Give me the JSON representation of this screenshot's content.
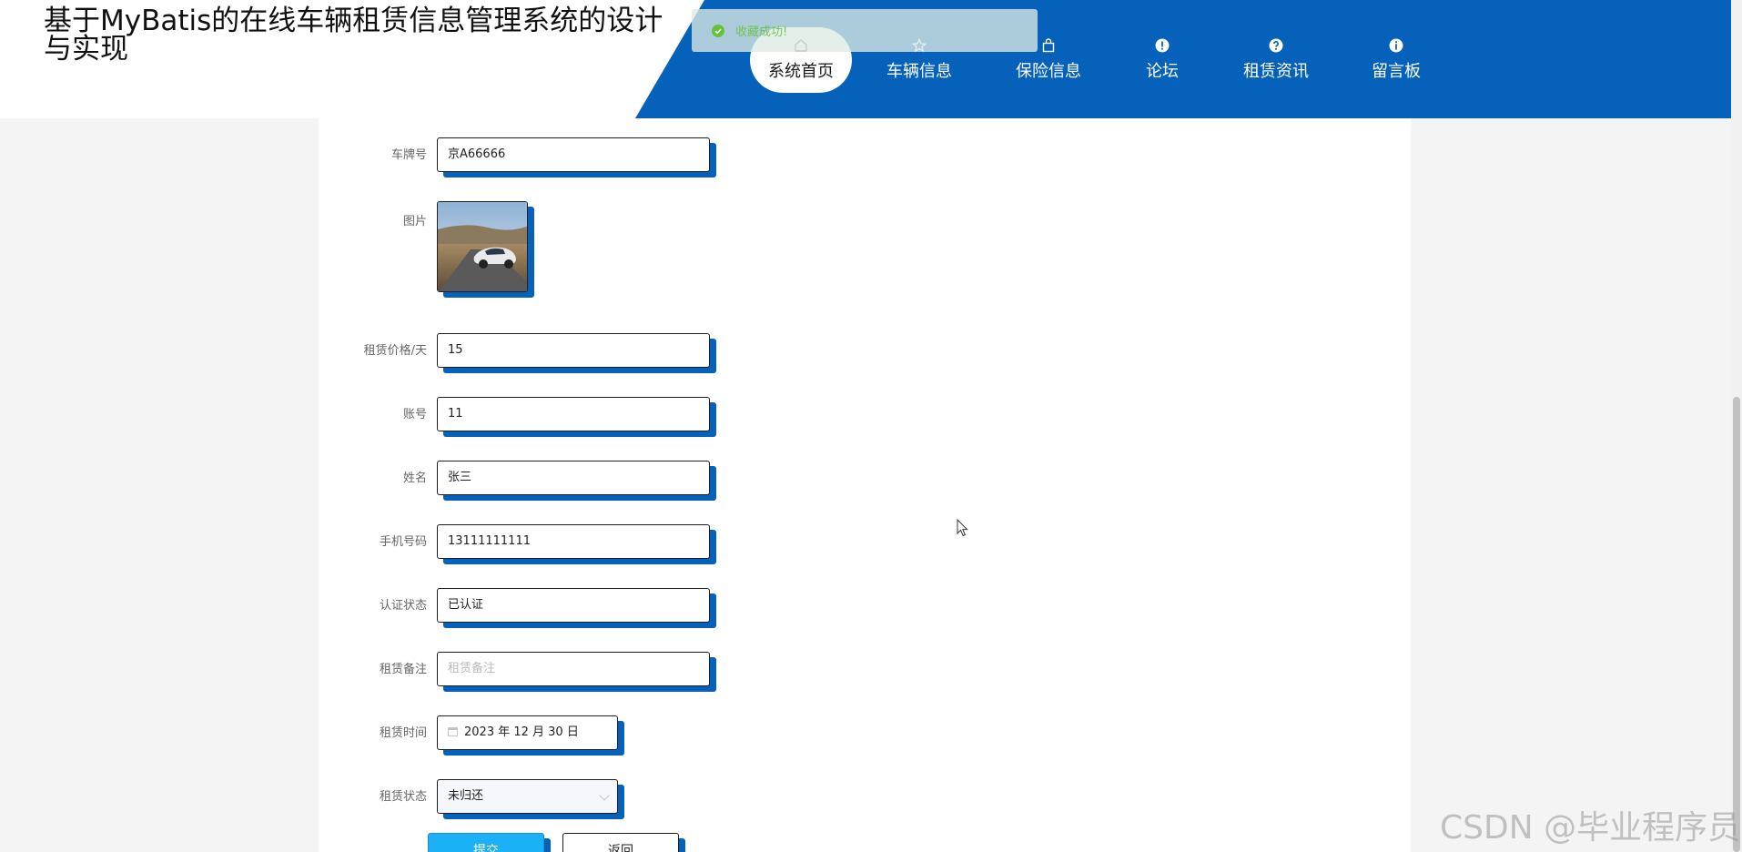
{
  "header": {
    "title": "基于MyBatis的在线车辆租赁信息管理系统的设计与实现"
  },
  "nav": {
    "items": [
      {
        "label": "系统首页",
        "icon": "home-icon"
      },
      {
        "label": "车辆信息",
        "icon": "star-icon"
      },
      {
        "label": "保险信息",
        "icon": "bag-icon"
      },
      {
        "label": "论坛",
        "icon": "exclamation-icon"
      },
      {
        "label": "租赁资讯",
        "icon": "question-icon"
      },
      {
        "label": "留言板",
        "icon": "info-icon"
      }
    ],
    "active_index": 0
  },
  "toast": {
    "text": "收藏成功!",
    "status": "success",
    "color": "#67c23a"
  },
  "form": {
    "plate": {
      "label": "车牌号",
      "value": "京A66666"
    },
    "photo": {
      "label": "图片"
    },
    "price": {
      "label": "租赁价格/天",
      "value": "15"
    },
    "account": {
      "label": "账号",
      "value": "11"
    },
    "name": {
      "label": "姓名",
      "value": "张三"
    },
    "phone": {
      "label": "手机号码",
      "value": "13111111111"
    },
    "auth_status": {
      "label": "认证状态",
      "value": "已认证"
    },
    "remark": {
      "label": "租赁备注",
      "value": "",
      "placeholder": "租赁备注"
    },
    "rent_time": {
      "label": "租赁时间",
      "value": "2023 年 12 月 30 日"
    },
    "rent_status": {
      "label": "租赁状态",
      "value": "未归还"
    }
  },
  "buttons": {
    "submit": "提交",
    "back": "返回"
  },
  "watermark": "CSDN @毕业程序员",
  "colors": {
    "brand_blue": "#0561b9",
    "submit_blue": "#1bb1f6",
    "success_green": "#67c23a"
  }
}
